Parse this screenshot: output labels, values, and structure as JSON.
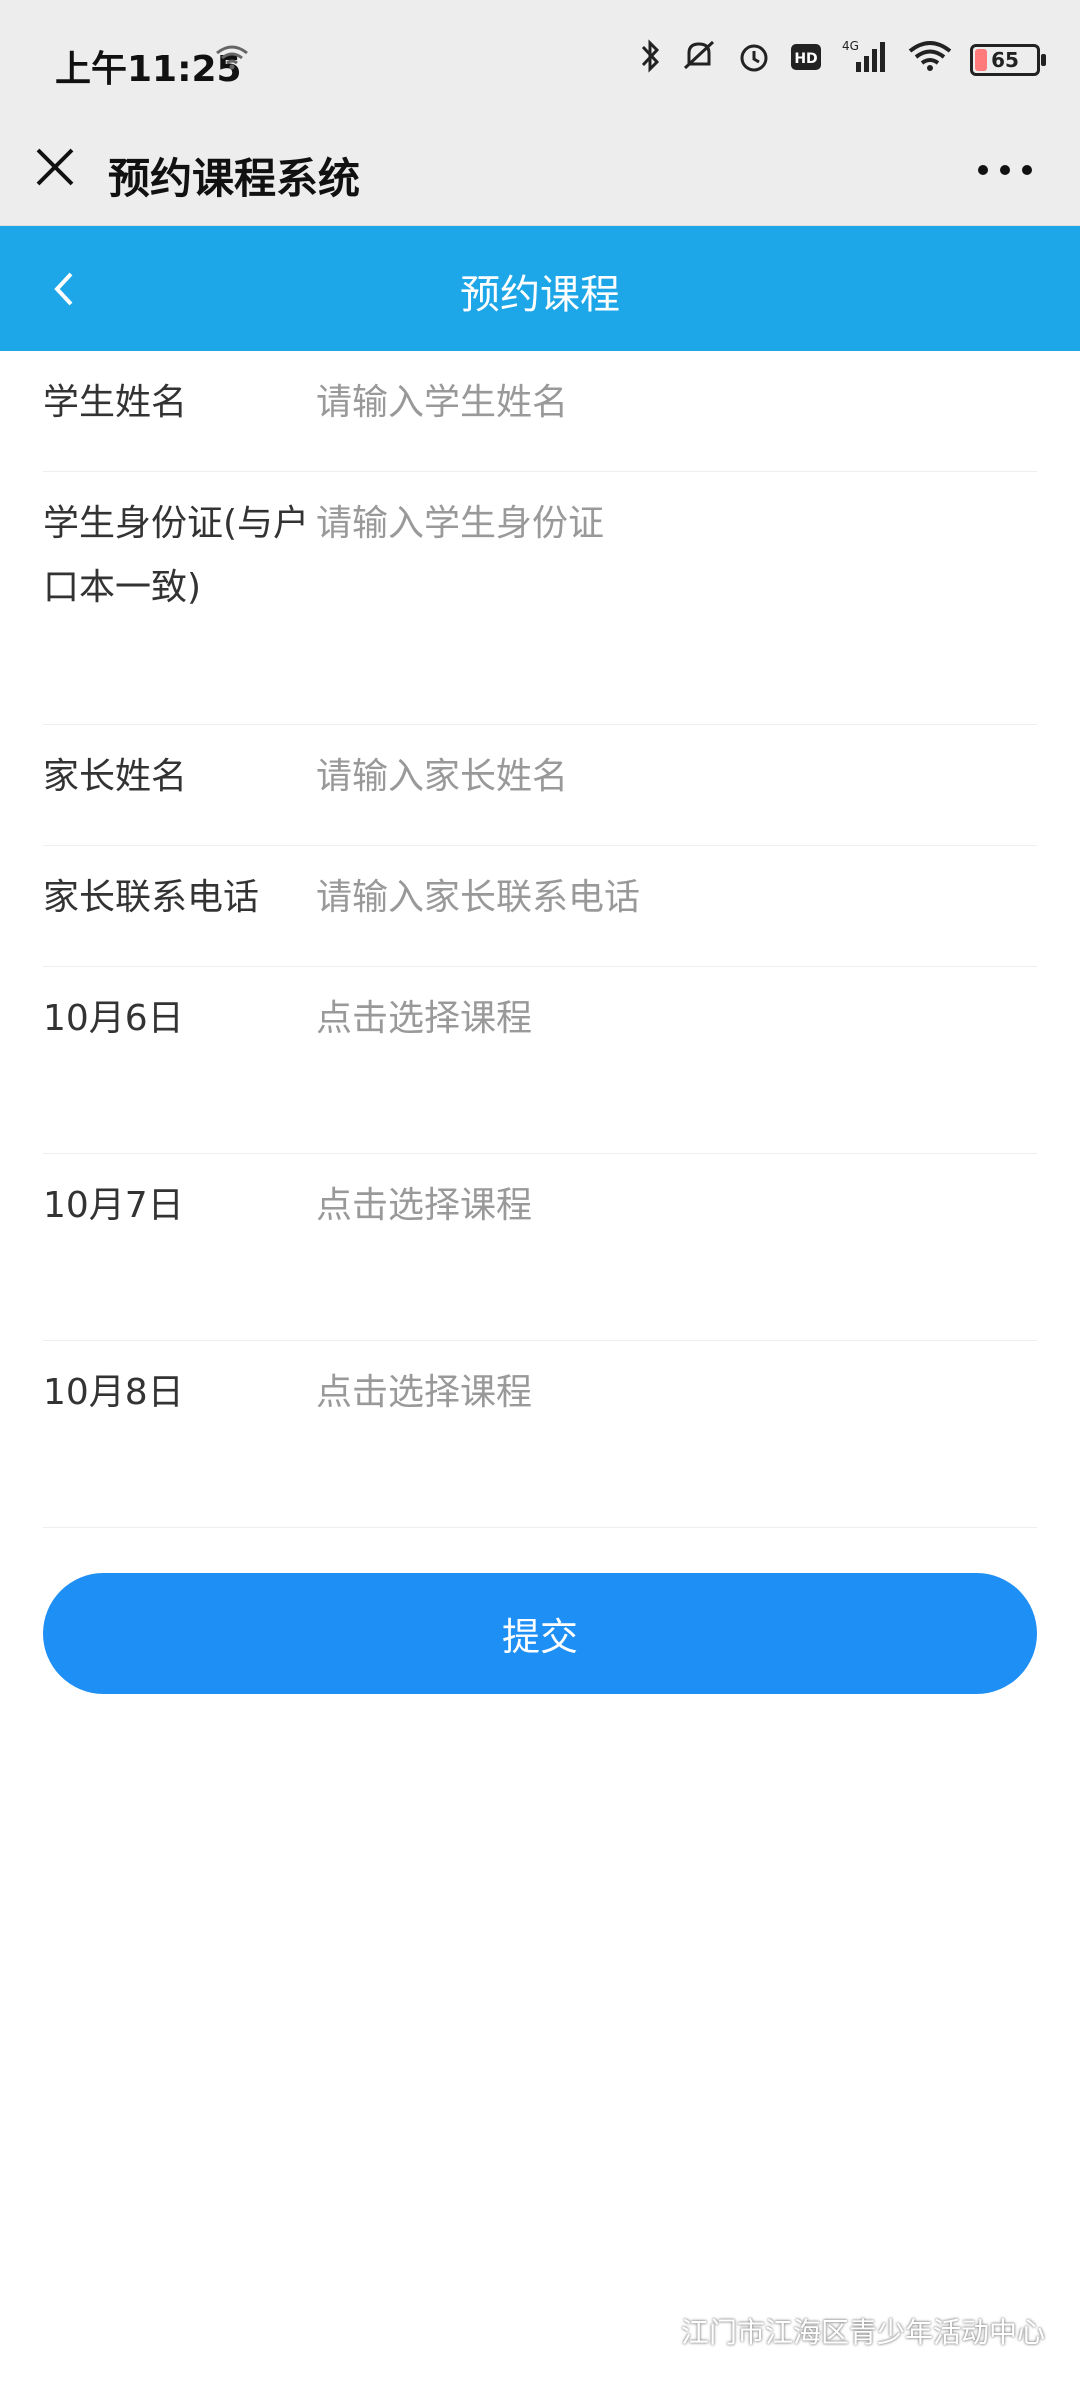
{
  "status_bar": {
    "time": "上午11:25",
    "network": "4G",
    "battery": "65"
  },
  "title_bar": {
    "title": "预约课程系统"
  },
  "nav_bar": {
    "title": "预约课程"
  },
  "form": {
    "rows": [
      {
        "label": "学生姓名",
        "placeholder": "请输入学生姓名"
      },
      {
        "label": "学生身份证(与户口本一致)",
        "placeholder": "请输入学生身份证"
      },
      {
        "label": "家长姓名",
        "placeholder": "请输入家长姓名"
      },
      {
        "label": "家长联系电话",
        "placeholder": "请输入家长联系电话"
      },
      {
        "label": "10月6日",
        "placeholder": "点击选择课程"
      },
      {
        "label": "10月7日",
        "placeholder": "点击选择课程"
      },
      {
        "label": "10月8日",
        "placeholder": "点击选择课程"
      }
    ],
    "submit_label": "提交"
  },
  "watermark": {
    "text": "江门市江海区青少年活动中心",
    "icon": "wechat-icon"
  },
  "colors": {
    "nav_blue": "#1da6e8",
    "button_blue": "#1e8ff5",
    "placeholder": "#999999"
  }
}
